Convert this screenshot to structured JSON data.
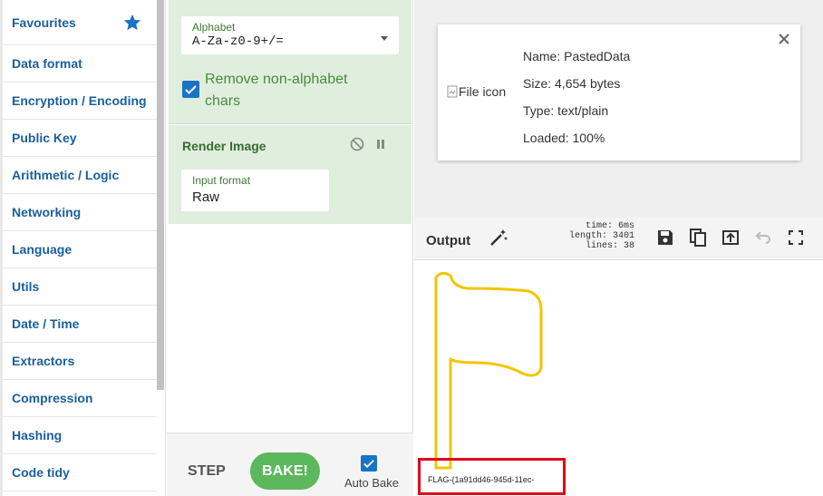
{
  "sidebar": {
    "items": [
      {
        "label": "Favourites"
      },
      {
        "label": "Data format"
      },
      {
        "label": "Encryption / Encoding"
      },
      {
        "label": "Public Key"
      },
      {
        "label": "Arithmetic / Logic"
      },
      {
        "label": "Networking"
      },
      {
        "label": "Language"
      },
      {
        "label": "Utils"
      },
      {
        "label": "Date / Time"
      },
      {
        "label": "Extractors"
      },
      {
        "label": "Compression"
      },
      {
        "label": "Hashing"
      },
      {
        "label": "Code tidy"
      }
    ]
  },
  "recipe": {
    "alphabet_label": "Alphabet",
    "alphabet_value": "A-Za-z0-9+/=",
    "remove_label": "Remove non-alphabet chars",
    "render_title": "Render Image",
    "input_format_label": "Input format",
    "input_format_value": "Raw",
    "step_label": "STEP",
    "bake_label": "BAKE!",
    "auto_bake_label": "Auto Bake"
  },
  "file": {
    "icon_alt": "File icon",
    "name": "Name: PastedData",
    "size": "Size: 4,654 bytes",
    "type": "Type: text/plain",
    "loaded": "Loaded: 100%"
  },
  "output": {
    "title": "Output",
    "time": "time:  6ms",
    "length": "length: 3401",
    "lines": "lines:   38",
    "flag_text": "FLAG-{1a91dd46-945d-11ec-"
  },
  "colors": {
    "accent": "#1a73c4",
    "bake_green": "#5cb85c",
    "recipe_bg": "#dfeedd",
    "flag_yellow": "#f2c500",
    "highlight_red": "#e0001b"
  }
}
